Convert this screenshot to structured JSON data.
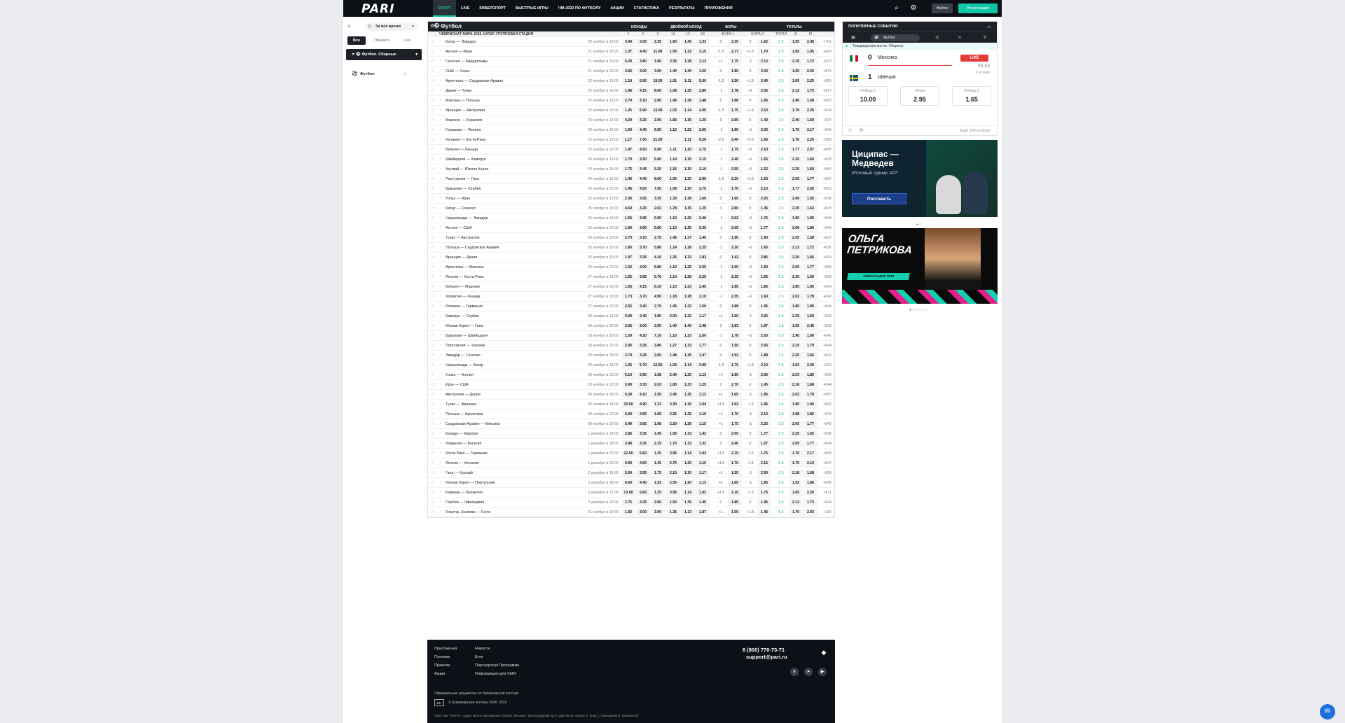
{
  "brand": {
    "logo": "PARI",
    "accent": "#10c6a8"
  },
  "nav": [
    "СПОРТ",
    "LIVE",
    "КИБЕРСПОРТ",
    "БЫСТРЫЕ ИГРЫ",
    "ЧМ-2022 ПО ФУТБОЛУ",
    "АКЦИИ",
    "СТАТИСТИКА",
    "РЕЗУЛЬТАТЫ",
    "ПРИЛОЖЕНИЯ"
  ],
  "auth": {
    "login": "Войти",
    "register": "Регистрация"
  },
  "sidebar": {
    "period": "За все время",
    "tabs": [
      "Все",
      "Прематч",
      "Live"
    ],
    "championship": "Футбол. Сборные",
    "sport": "Футбол"
  },
  "main": {
    "title": "Футбол",
    "groups": [
      "ИСХОДЫ",
      "ДВОЙНОЙ ИСХОД",
      "ФОРЫ",
      "ТОТАЛЫ"
    ],
    "championship": "ЧЕМПИОНАТ МИРА 2022. КАТАР. ГРУППОВАЯ СТАДИЯ",
    "columns": [
      "1",
      "X",
      "2",
      "1X",
      "12",
      "X2",
      "ФОРА 1",
      "",
      "ФОРА 2",
      "",
      "ТОТАЛ",
      "Б",
      "М"
    ]
  },
  "matches": [
    [
      "Катар — Эквадор",
      "20 ноября в 19:00",
      "3.40",
      "3.05",
      "2.35",
      "1.60",
      "1.40",
      "1.33",
      "0",
      "2.35",
      "0",
      "1.62",
      "1.5",
      "1.55",
      "2.45",
      "+751"
    ],
    [
      "Англия — Иран",
      "21 ноября в 16:00",
      "1.37",
      "4.40",
      "11.00",
      "1.05",
      "1.22",
      "3.15",
      "-1.5",
      "2.17",
      "+1.5",
      "1.70",
      "2.5",
      "1.85",
      "1.95",
      "+825"
    ],
    [
      "Сенегал — Нидерланды",
      "21 ноября в 19:00",
      "6.20",
      "3.80",
      "1.60",
      "2.35",
      "1.28",
      "1.13",
      "+1",
      "1.75",
      "-1",
      "2.13",
      "2.5",
      "2.15",
      "1.72",
      "+870"
    ],
    [
      "США — Уэльс",
      "21 ноября в 22:00",
      "2.65",
      "3.00",
      "3.00",
      "1.40",
      "1.40",
      "1.50",
      "0",
      "1.80",
      "0",
      "2.03",
      "1.5",
      "1.55",
      "2.50",
      "+871"
    ],
    [
      "Аргентина — Саудовская Аравия",
      "22 ноября в 13:00",
      "1.18",
      "6.90",
      "19.00",
      "1.01",
      "1.11",
      "5.00",
      "-1.5",
      "1.56",
      "+1.5",
      "2.40",
      "2.5",
      "1.65",
      "2.25",
      "+809"
    ],
    [
      "Дания — Тунис",
      "22 ноября в 16:00",
      "1.45",
      "4.15",
      "8.00",
      "1.08",
      "1.25",
      "2.80",
      "-1",
      "1.78",
      "+1",
      "2.05",
      "2.5",
      "2.12",
      "1.75",
      "+817"
    ],
    [
      "Мексика — Польша",
      "22 ноября в 19:00",
      "2.70",
      "3.10",
      "2.80",
      "1.45",
      "1.38",
      "1.48",
      "0",
      "1.88",
      "0",
      "1.95",
      "2.5",
      "2.40",
      "1.58",
      "+857"
    ],
    [
      "Франция — Австралия",
      "22 ноября в 22:00",
      "1.25",
      "5.90",
      "13.00",
      "1.03",
      "1.14",
      "4.05",
      "-1.5",
      "1.75",
      "+1.5",
      "2.10",
      "2.5",
      "1.70",
      "2.20",
      "+824"
    ],
    [
      "Марокко — Хорватия",
      "23 ноября в 13:00",
      "4.20",
      "3.20",
      "2.00",
      "1.83",
      "1.35",
      "1.25",
      "0",
      "2.85",
      "0",
      "1.43",
      "2.5",
      "2.40",
      "1.60",
      "+837"
    ],
    [
      "Германия — Япония",
      "23 ноября в 16:00",
      "1.50",
      "4.40",
      "6.50",
      "1.12",
      "1.22",
      "2.65",
      "-1",
      "1.80",
      "+1",
      "2.03",
      "2.5",
      "1.70",
      "2.17",
      "+849"
    ],
    [
      "Испания — Коста-Рика",
      "23 ноября в 19:00",
      "1.17",
      "7.00",
      "21.00",
      "",
      "1.11",
      "5.20",
      "-2.5",
      "2.40",
      "+2.5",
      "1.60",
      "2.5",
      "1.70",
      "2.20",
      "+585"
    ],
    [
      "Бельгия — Канада",
      "23 ноября в 22:00",
      "1.47",
      "4.50",
      "6.90",
      "1.11",
      "1.20",
      "2.75",
      "-1",
      "1.75",
      "+1",
      "2.10",
      "2.5",
      "1.77",
      "2.07",
      "+845"
    ],
    [
      "Швейцария — Камерун",
      "24 ноября в 13:00",
      "1.70",
      "3.50",
      "5.60",
      "1.14",
      "1.30",
      "2.15",
      "-1",
      "2.40",
      "+1",
      "1.55",
      "2.5",
      "2.35",
      "1.60",
      "+828"
    ],
    [
      "Уругвай — Южная Корея",
      "24 ноября в 16:00",
      "1.75",
      "3.45",
      "5.20",
      "1.16",
      "1.30",
      "2.10",
      "-1",
      "2.55",
      "+1",
      "1.52",
      "2.5",
      "2.35",
      "1.60",
      "+840"
    ],
    [
      "Португалия — Гана",
      "24 ноября в 19:00",
      "1.40",
      "4.40",
      "8.00",
      "1.06",
      "1.20",
      "2.95",
      "-1.5",
      "2.20",
      "+1.5",
      "1.63",
      "2.5",
      "2.05",
      "1.77",
      "+807"
    ],
    [
      "Бразилия — Сербия",
      "24 ноября в 22:00",
      "1.45",
      "4.50",
      "7.50",
      "1.09",
      "1.20",
      "2.75",
      "-1",
      "1.70",
      "+1",
      "2.13",
      "2.5",
      "1.77",
      "2.05",
      "+853"
    ],
    [
      "Уэльс — Иран",
      "25 ноября в 13:00",
      "2.35",
      "3.05",
      "3.35",
      "1.33",
      "1.38",
      "1.60",
      "0",
      "1.65",
      "0",
      "2.25",
      "2.5",
      "2.45",
      "1.55",
      "+838"
    ],
    [
      "Катар — Сенегал",
      "25 ноября в 16:00",
      "4.60",
      "3.25",
      "2.02",
      "1.78",
      "1.35",
      "1.25",
      "0",
      "2.80",
      "0",
      "1.45",
      "2.5",
      "2.30",
      "1.63",
      "+843"
    ],
    [
      "Нидерланды — Эквадор",
      "25 ноября в 19:00",
      "1.56",
      "3.95",
      "5.90",
      "1.13",
      "1.25",
      "2.40",
      "-1",
      "2.02",
      "+1",
      "1.76",
      "2.5",
      "1.90",
      "1.90",
      "+844"
    ],
    [
      "Англия — США",
      "25 ноября в 22:00",
      "1.60",
      "3.90",
      "5.80",
      "1.13",
      "1.25",
      "2.35",
      "-1",
      "2.05",
      "+1",
      "1.77",
      "2.5",
      "2.00",
      "1.80",
      "+840"
    ],
    [
      "Тунис — Австралия",
      "26 ноября в 13:00",
      "2.75",
      "3.10",
      "2.75",
      "1.45",
      "1.37",
      "1.45",
      "0",
      "1.90",
      "0",
      "1.90",
      "2.5",
      "2.35",
      "1.58",
      "+837"
    ],
    [
      "Польша — Саудовская Аравия",
      "26 ноября в 16:00",
      "1.65",
      "3.70",
      "5.80",
      "1.14",
      "1.28",
      "2.25",
      "-1",
      "2.20",
      "+1",
      "1.65",
      "2.5",
      "2.13",
      "1.72",
      "+836"
    ],
    [
      "Франция — Дания",
      "26 ноября в 19:00",
      "1.97",
      "3.35",
      "4.10",
      "1.25",
      "1.33",
      "1.83",
      "0",
      "1.43",
      "0",
      "2.85",
      "2.5",
      "2.20",
      "1.66",
      "+843"
    ],
    [
      "Аргентина — Мексика",
      "26 ноября в 22:00",
      "1.52",
      "4.00",
      "6.80",
      "1.10",
      "1.25",
      "2.55",
      "-1",
      "1.90",
      "+1",
      "1.90",
      "2.5",
      "2.05",
      "1.77",
      "+855"
    ],
    [
      "Япония — Коста-Рика",
      "27 ноября в 13:00",
      "1.65",
      "3.65",
      "5.70",
      "1.14",
      "1.28",
      "2.25",
      "-1",
      "2.25",
      "+1",
      "1.65",
      "2.5",
      "2.30",
      "1.65",
      "+838"
    ],
    [
      "Бельгия — Марокко",
      "27 ноября в 16:00",
      "1.55",
      "4.15",
      "6.10",
      "1.13",
      "1.23",
      "2.45",
      "-1",
      "1.95",
      "+1",
      "1.85",
      "2.5",
      "1.85",
      "1.95",
      "+843"
    ],
    [
      "Хорватия — Канада",
      "27 ноября в 19:00",
      "1.73",
      "3.70",
      "4.90",
      "1.18",
      "1.28",
      "2.10",
      "-1",
      "2.35",
      "+1",
      "1.60",
      "2.5",
      "2.02",
      "1.78",
      "+842"
    ],
    [
      "Испания — Германия",
      "27 ноября в 22:00",
      "2.55",
      "3.40",
      "2.75",
      "1.45",
      "1.32",
      "1.50",
      "0",
      "1.88",
      "0",
      "1.95",
      "2.5",
      "1.90",
      "1.90",
      "+844"
    ],
    [
      "Камерун — Сербия",
      "28 ноября в 13:00",
      "5.00",
      "3.40",
      "1.80",
      "2.00",
      "1.32",
      "1.17",
      "+1",
      "1.50",
      "-1",
      "2.65",
      "2.5",
      "2.35",
      "1.60",
      "+839"
    ],
    [
      "Южная Корея — Гана",
      "28 ноября в 16:00",
      "2.65",
      "3.00",
      "2.90",
      "1.40",
      "1.40",
      "1.48",
      "0",
      "1.83",
      "0",
      "1.97",
      "1.5",
      "1.55",
      "2.45",
      "+832"
    ],
    [
      "Бразилия — Швейцария",
      "28 ноября в 19:00",
      "1.50",
      "4.20",
      "7.10",
      "1.10",
      "1.23",
      "2.60",
      "-1",
      "1.78",
      "+1",
      "2.03",
      "2.5",
      "1.90",
      "1.90",
      "+840"
    ],
    [
      "Португалия — Уругвай",
      "28 ноября в 22:00",
      "2.05",
      "3.35",
      "3.80",
      "1.27",
      "1.33",
      "1.77",
      "0",
      "1.50",
      "0",
      "2.55",
      "2.5",
      "2.15",
      "1.70",
      "+844"
    ],
    [
      "Эквадор — Сенегал",
      "29 ноября в 18:00",
      "2.70",
      "3.25",
      "2.65",
      "1.48",
      "1.35",
      "1.47",
      "0",
      "1.92",
      "0",
      "1.88",
      "2.5",
      "2.25",
      "1.65",
      "+842"
    ],
    [
      "Нидерланды — Катар",
      "29 ноября в 18:00",
      "1.25",
      "5.70",
      "12.50",
      "1.03",
      "1.14",
      "3.95",
      "-1.5",
      "1.75",
      "+1.5",
      "2.10",
      "2.5",
      "1.63",
      "2.30",
      "+812"
    ],
    [
      "Уэльс — Англия",
      "29 ноября в 22:00",
      "6.10",
      "3.90",
      "1.58",
      "2.40",
      "1.25",
      "1.13",
      "+1",
      "1.80",
      "-1",
      "2.00",
      "2.5",
      "2.03",
      "1.80",
      "+836"
    ],
    [
      "Иран — США",
      "29 ноября в 22:00",
      "3.90",
      "3.30",
      "2.03",
      "1.80",
      "1.33",
      "1.25",
      "0",
      "2.70",
      "0",
      "1.45",
      "2.5",
      "2.18",
      "1.68",
      "+844"
    ],
    [
      "Австралия — Дания",
      "30 ноября в 18:00",
      "6.30",
      "4.10",
      "1.55",
      "2.45",
      "1.25",
      "1.12",
      "+1",
      "1.65",
      "-1",
      "1.95",
      "2.5",
      "2.02",
      "1.78",
      "+857"
    ],
    [
      "Тунис — Франция",
      "30 ноября в 18:00",
      "10.50",
      "4.90",
      "1.33",
      "3.30",
      "1.16",
      "1.04",
      "+1.5",
      "1.62",
      "-1.5",
      "1.96",
      "2.5",
      "1.90",
      "1.90",
      "+802"
    ],
    [
      "Польша — Аргентина",
      "30 ноября в 22:00",
      "5.30",
      "3.65",
      "1.65",
      "2.25",
      "1.25",
      "1.16",
      "+1",
      "1.70",
      "-1",
      "2.13",
      "2.5",
      "1.98",
      "1.82",
      "+841"
    ],
    [
      "Саудовская Аравия — Мексика",
      "30 ноября в 22:00",
      "5.40",
      "3.65",
      "1.68",
      "2.20",
      "1.28",
      "1.15",
      "+1",
      "1.75",
      "-1",
      "2.25",
      "2.5",
      "2.05",
      "1.77",
      "+840"
    ],
    [
      "Канада — Марокко",
      "1 декабря в 18:00",
      "2.85",
      "3.35",
      "2.45",
      "1.55",
      "1.33",
      "1.42",
      "0",
      "2.05",
      "0",
      "1.77",
      "2.5",
      "2.25",
      "1.65",
      "+838"
    ],
    [
      "Хорватия — Бельгия",
      "1 декабря в 18:00",
      "3.40",
      "3.35",
      "2.15",
      "1.70",
      "1.33",
      "1.32",
      "0",
      "2.40",
      "0",
      "1.57",
      "2.5",
      "2.05",
      "1.77",
      "+844"
    ],
    [
      "Коста-Рика — Германия",
      "1 декабря в 22:00",
      "12.50",
      "5.60",
      "1.25",
      "3.95",
      "1.14",
      "1.03",
      "+1.5",
      "2.10",
      "-1.5",
      "1.75",
      "2.5",
      "1.70",
      "2.17",
      "+808"
    ],
    [
      "Япония — Испания",
      "1 декабря в 22:00",
      "6.90",
      "4.60",
      "1.45",
      "2.75",
      "1.20",
      "1.10",
      "+1.5",
      "1.70",
      "-1.5",
      "2.15",
      "2.5",
      "1.75",
      "2.10",
      "+807"
    ],
    [
      "Гана — Уругвай",
      "2 декабря в 18:00",
      "5.00",
      "3.55",
      "1.75",
      "2.10",
      "1.30",
      "1.17",
      "+1",
      "1.55",
      "-1",
      "2.50",
      "2.5",
      "2.18",
      "1.68",
      "+838"
    ],
    [
      "Южная Корея — Португалия",
      "2 декабря в 18:00",
      "6.60",
      "4.40",
      "1.52",
      "2.55",
      "1.20",
      "1.13",
      "+1",
      "1.85",
      "-1",
      "1.85",
      "2.5",
      "1.92",
      "1.86",
      "+846"
    ],
    [
      "Камерун — Бразилия",
      "2 декабря в 22:00",
      "13.00",
      "5.60",
      "1.25",
      "3.95",
      "1.14",
      "1.02",
      "+1.5",
      "2.10",
      "-1.5",
      "1.75",
      "2.5",
      "1.65",
      "2.20",
      "+811"
    ],
    [
      "Сербия — Швейцария",
      "2 декабря в 22:00",
      "2.75",
      "3.25",
      "2.60",
      "1.50",
      "1.35",
      "1.45",
      "0",
      "1.85",
      "0",
      "1.95",
      "2.5",
      "2.12",
      "1.72",
      "+844"
    ],
    [
      "3 матча. Хозяева — Гости",
      "21 ноября в 16:00",
      "1.83",
      "3.00",
      "3.00",
      "1.35",
      "1.13",
      "1.87",
      "+1",
      "1.50",
      "+1.5",
      "1.45",
      "6.5",
      "1.70",
      "2.03",
      "+116"
    ]
  ],
  "popular": {
    "title": "ПОПУЛЯРНЫЕ СОБЫТИЯ",
    "tab_active": "Футбол",
    "league": "Товарищеские матчи. Сборные",
    "team1": "Мексика",
    "score1": "0",
    "team2": "Швеция",
    "score2": "1",
    "live": "LIVE",
    "time": "56:43",
    "half": "2-й тайм",
    "odds": [
      {
        "label": "Победа 1",
        "value": "10.00"
      },
      {
        "label": "Ничья",
        "value": "2.95"
      },
      {
        "label": "Победа 2",
        "value": "1.65"
      }
    ],
    "more": "Еще 338 коэфов"
  },
  "banner1": {
    "title_line1": "Циципас —",
    "title_line2": "Медведев",
    "subtitle": "Итоговый турнир ATP",
    "button": "Поставить"
  },
  "banner2": {
    "title_line1": "ОЛЬГА",
    "title_line2": "ПЕТРИКОВА",
    "subtitle": "АМБАССАДОР PARI"
  },
  "footer": {
    "col1": [
      "Приложения",
      "Платежи",
      "Правила",
      "Акции"
    ],
    "col2": [
      "Новости",
      "Блог",
      "Партнерская Программа",
      "Информация для СМИ"
    ],
    "phone": "8 (800) 770-73-71",
    "email": "support@pari.ru",
    "docs": "Официальные документы по букмекерской конторе",
    "age": "18+",
    "copyright": "© Букмекерская контора PARI, 2022",
    "legal": "ООО «БК «ПАРИ». Адрес места нахождения: 119315, Москва г, Волгоградский пр-кт, дом № 43, корпус 3, этаж 1, помещение 6, комната 80"
  }
}
